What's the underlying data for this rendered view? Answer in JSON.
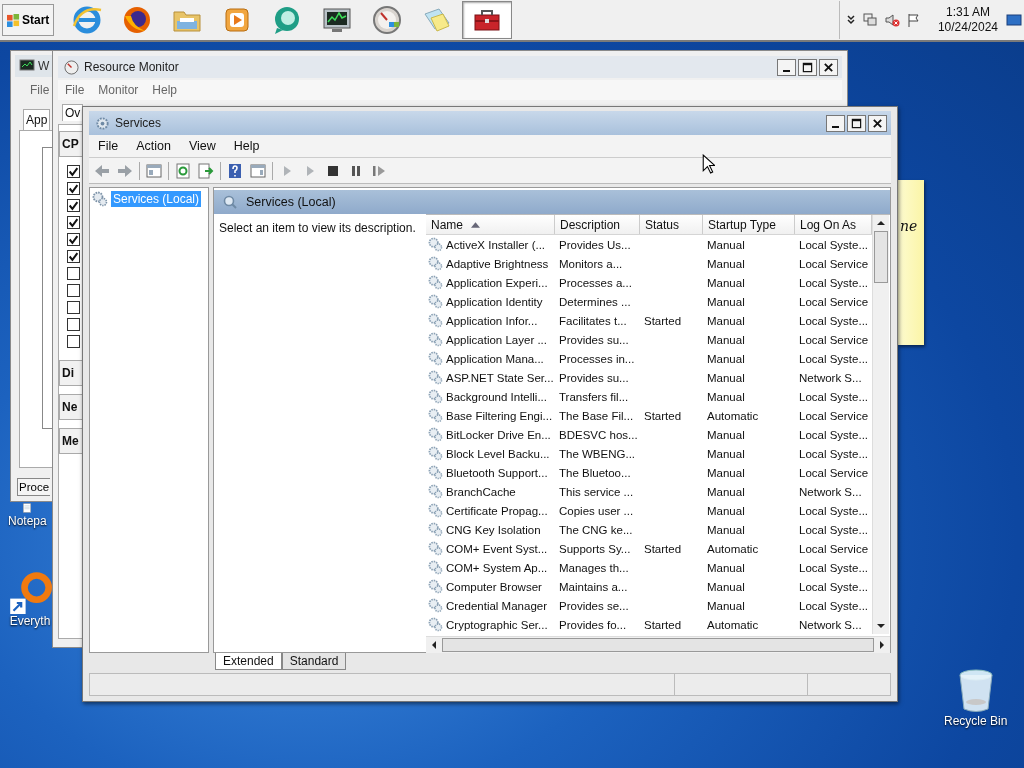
{
  "taskbar": {
    "start_label": "Start",
    "apps": [
      {
        "kind": "globe",
        "selected": false
      },
      {
        "kind": "fox",
        "selected": false
      },
      {
        "kind": "folder",
        "selected": false
      },
      {
        "kind": "media",
        "selected": false
      },
      {
        "kind": "bubble",
        "selected": false
      },
      {
        "kind": "monitor",
        "selected": false
      },
      {
        "kind": "gauge",
        "selected": false
      },
      {
        "kind": "notes",
        "selected": false
      },
      {
        "kind": "toolbox",
        "selected": true
      }
    ],
    "clock": {
      "time": "1:31 AM",
      "date": "10/24/2024"
    }
  },
  "desktop_icons": [
    {
      "kind": "notepad",
      "label": "Notepa"
    },
    {
      "kind": "everything",
      "label": "Everyth"
    },
    {
      "kind": "recycle",
      "label": "Recycle Bin"
    }
  ],
  "task_manager": {
    "title": "W",
    "menu": [
      "File"
    ],
    "tab": "App",
    "button": "Proce"
  },
  "resource_monitor": {
    "title": "Resource Monitor",
    "menu": [
      "File",
      "Monitor",
      "Help"
    ],
    "tab": "Ov",
    "cpu_section": {
      "label": "CP",
      "checkboxes": [
        {
          "checked": true
        },
        {
          "checked": true
        },
        {
          "checked": true
        },
        {
          "checked": true
        },
        {
          "checked": true
        },
        {
          "checked": true
        },
        {
          "checked": false
        },
        {
          "checked": false
        },
        {
          "checked": false
        },
        {
          "checked": false
        },
        {
          "checked": false
        }
      ]
    },
    "collapsed_sections": [
      "Di",
      "Ne",
      "Me"
    ]
  },
  "sticky_note": {
    "text": "ne"
  },
  "services": {
    "title": "Services",
    "menu": [
      "File",
      "Action",
      "View",
      "Help"
    ],
    "tree": [
      {
        "label": "Services (Local)",
        "selected": true
      }
    ],
    "pane_title": "Services (Local)",
    "description_hint": "Select an item to view its description.",
    "columns": [
      {
        "label": "Name",
        "sorted": true
      },
      {
        "label": "Description",
        "sorted": false
      },
      {
        "label": "Status",
        "sorted": false
      },
      {
        "label": "Startup Type",
        "sorted": false
      },
      {
        "label": "Log On As",
        "sorted": false
      }
    ],
    "rows": [
      {
        "name": "ActiveX Installer (...",
        "description": "Provides Us...",
        "startup": "Manual",
        "logon": "Local Syste..."
      },
      {
        "name": "Adaptive Brightness",
        "description": "Monitors a...",
        "startup": "Manual",
        "logon": "Local Service"
      },
      {
        "name": "Application Experi...",
        "description": "Processes a...",
        "startup": "Manual",
        "logon": "Local Syste..."
      },
      {
        "name": "Application Identity",
        "description": "Determines ...",
        "startup": "Manual",
        "logon": "Local Service"
      },
      {
        "name": "Application Infor...",
        "description": "Facilitates t...",
        "status": "Started",
        "startup": "Manual",
        "logon": "Local Syste..."
      },
      {
        "name": "Application Layer ...",
        "description": "Provides su...",
        "startup": "Manual",
        "logon": "Local Service"
      },
      {
        "name": "Application Mana...",
        "description": "Processes in...",
        "startup": "Manual",
        "logon": "Local Syste..."
      },
      {
        "name": "ASP.NET State Ser...",
        "description": "Provides su...",
        "startup": "Manual",
        "logon": "Network S..."
      },
      {
        "name": "Background Intelli...",
        "description": "Transfers fil...",
        "startup": "Manual",
        "logon": "Local Syste..."
      },
      {
        "name": "Base Filtering Engi...",
        "description": "The Base Fil...",
        "status": "Started",
        "startup": "Automatic",
        "logon": "Local Service"
      },
      {
        "name": "BitLocker Drive En...",
        "description": "BDESVC hos...",
        "startup": "Manual",
        "logon": "Local Syste..."
      },
      {
        "name": "Block Level Backu...",
        "description": "The WBENG...",
        "startup": "Manual",
        "logon": "Local Syste..."
      },
      {
        "name": "Bluetooth Support...",
        "description": "The Bluetoo...",
        "startup": "Manual",
        "logon": "Local Service"
      },
      {
        "name": "BranchCache",
        "description": "This service ...",
        "startup": "Manual",
        "logon": "Network S..."
      },
      {
        "name": "Certificate Propag...",
        "description": "Copies user ...",
        "startup": "Manual",
        "logon": "Local Syste..."
      },
      {
        "name": "CNG Key Isolation",
        "description": "The CNG ke...",
        "startup": "Manual",
        "logon": "Local Syste..."
      },
      {
        "name": "COM+ Event Syst...",
        "description": "Supports Sy...",
        "status": "Started",
        "startup": "Automatic",
        "logon": "Local Service"
      },
      {
        "name": "COM+ System Ap...",
        "description": "Manages th...",
        "startup": "Manual",
        "logon": "Local Syste..."
      },
      {
        "name": "Computer Browser",
        "description": "Maintains a...",
        "startup": "Manual",
        "logon": "Local Syste..."
      },
      {
        "name": "Credential Manager",
        "description": "Provides se...",
        "startup": "Manual",
        "logon": "Local Syste..."
      },
      {
        "name": "Cryptographic Ser...",
        "description": "Provides fo...",
        "status": "Started",
        "startup": "Automatic",
        "logon": "Network S..."
      }
    ],
    "view_tabs": [
      {
        "label": "Extended",
        "selected": true
      },
      {
        "label": "Standard",
        "selected": false
      }
    ]
  }
}
